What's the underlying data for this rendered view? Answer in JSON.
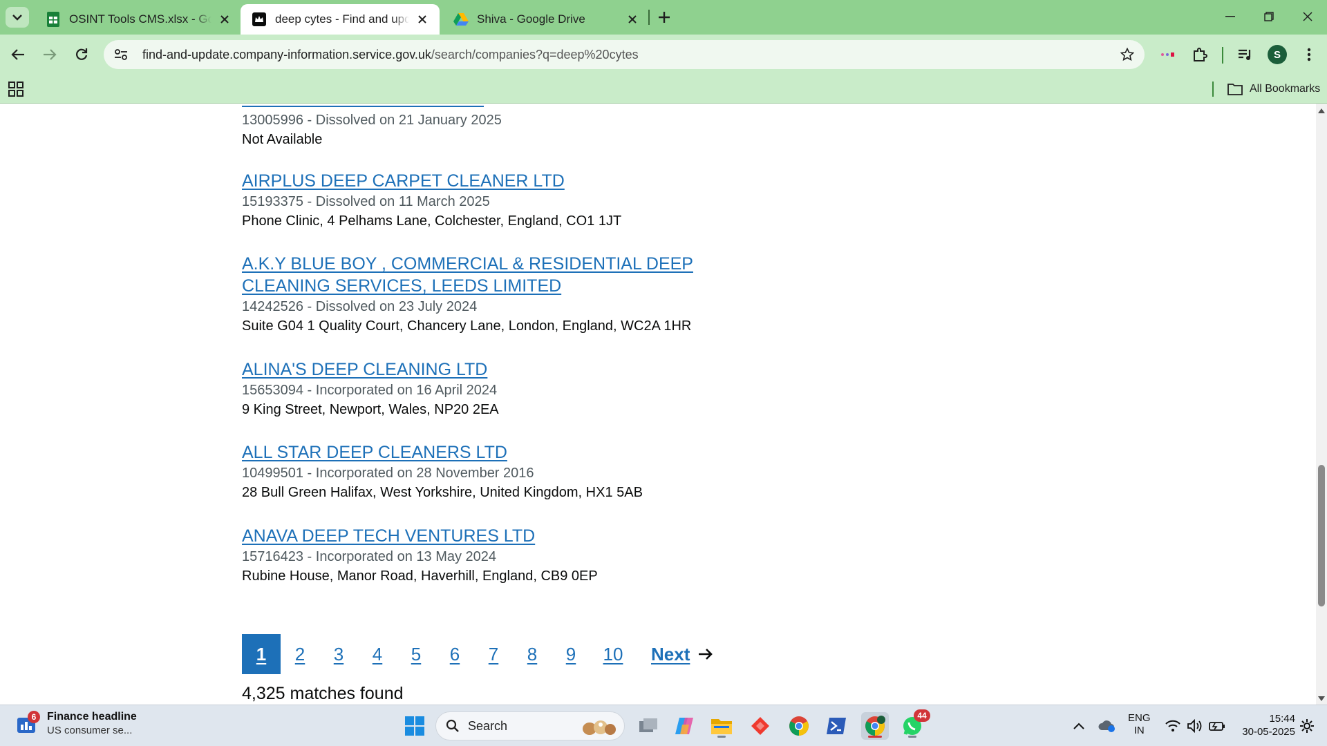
{
  "browser": {
    "tabs": [
      {
        "title": "OSINT Tools CMS.xlsx - Google",
        "icon": "sheets-icon"
      },
      {
        "title": "deep cytes - Find and update c",
        "icon": "crown-icon"
      },
      {
        "title": "Shiva - Google Drive",
        "icon": "drive-icon"
      }
    ],
    "url_host": "find-and-update.company-information.service.gov.uk",
    "url_path": "/search/companies?q=deep%20cytes",
    "profile_initial": "S",
    "bookmarks_label": "All Bookmarks",
    "accent": "#8fd18f"
  },
  "results": [
    {
      "name": "",
      "meta": "13005996 - Dissolved on 21 January 2025",
      "address": "Not Available"
    },
    {
      "name": "AIRPLUS DEEP CARPET CLEANER LTD",
      "meta": "15193375 - Dissolved on 11 March 2025",
      "address": "Phone Clinic, 4 Pelhams Lane, Colchester, England, CO1 1JT"
    },
    {
      "name": "A.K.Y BLUE BOY , COMMERCIAL & RESIDENTIAL DEEP CLEANING SERVICES, LEEDS LIMITED",
      "meta": "14242526 - Dissolved on 23 July 2024",
      "address": "Suite G04 1 Quality Court, Chancery Lane, London, England, WC2A 1HR"
    },
    {
      "name": "ALINA'S DEEP CLEANING LTD",
      "meta": "15653094 - Incorporated on 16 April 2024",
      "address": "9 King Street, Newport, Wales, NP20 2EA"
    },
    {
      "name": "ALL STAR DEEP CLEANERS LTD",
      "meta": "10499501 - Incorporated on 28 November 2016",
      "address": "28 Bull Green Halifax, West Yorkshire, United Kingdom, HX1 5AB"
    },
    {
      "name": "ANAVA DEEP TECH VENTURES LTD",
      "meta": "15716423 - Incorporated on 13 May 2024",
      "address": "Rubine House, Manor Road, Haverhill, England, CB9 0EP"
    }
  ],
  "pagination": {
    "current": "1",
    "pages": [
      "2",
      "3",
      "4",
      "5",
      "6",
      "7",
      "8",
      "9",
      "10"
    ],
    "next_label": "Next"
  },
  "matches_text": "4,325 matches found",
  "taskbar": {
    "news_badge": "6",
    "news_title": "Finance headline",
    "news_sub": "US consumer se...",
    "search_label": "Search",
    "whatsapp_badge": "44",
    "lang_line1": "ENG",
    "lang_line2": "IN",
    "time": "15:44",
    "date": "30-05-2025"
  }
}
